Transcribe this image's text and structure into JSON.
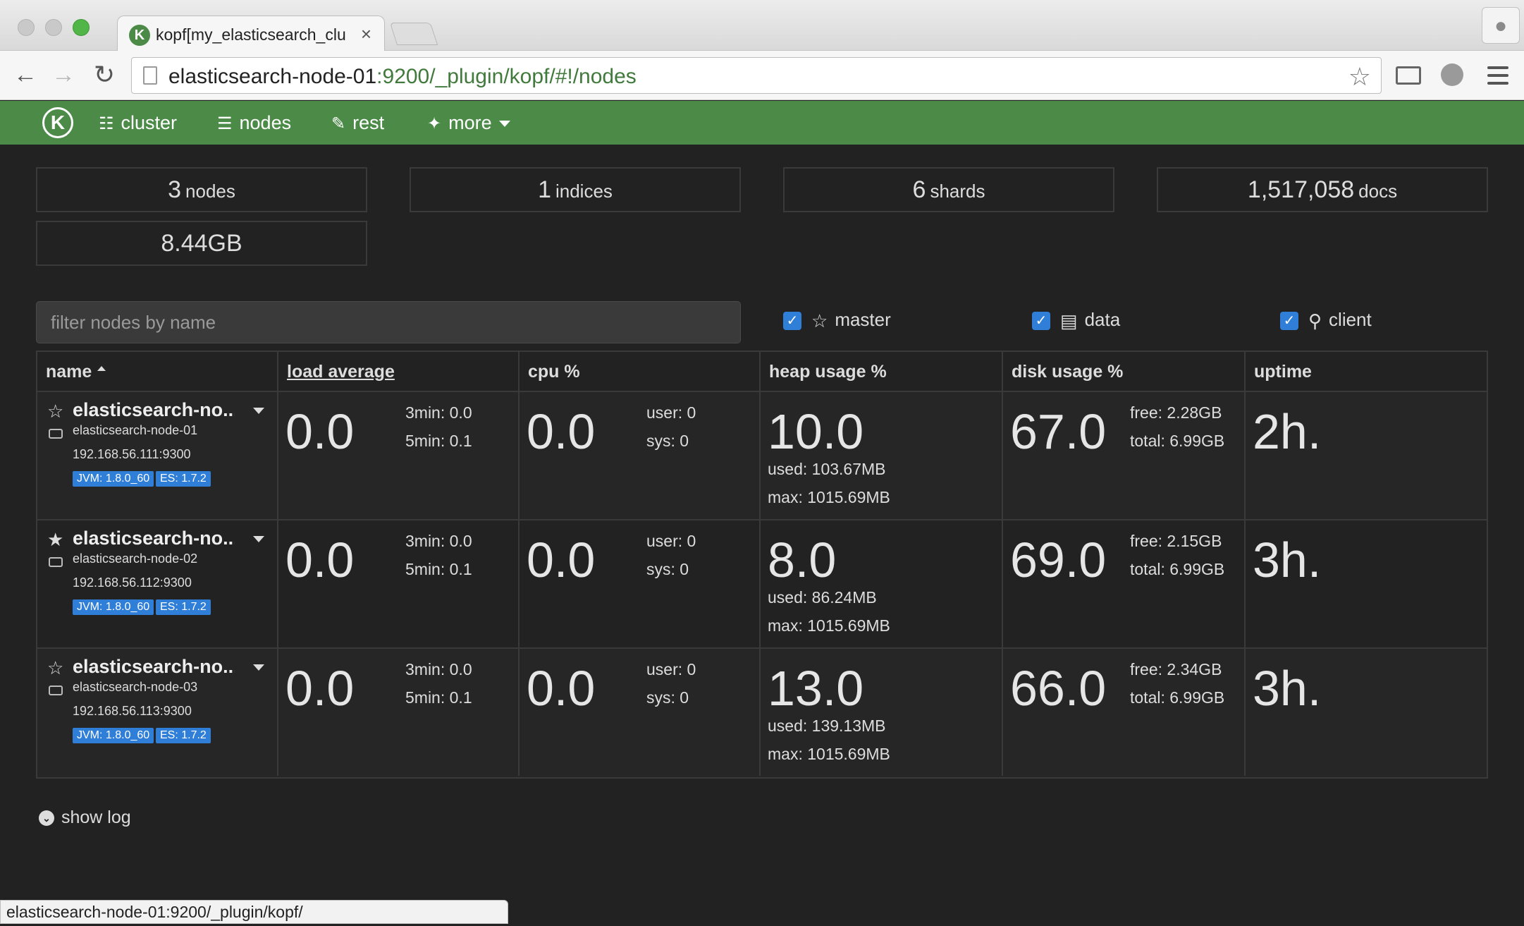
{
  "browser": {
    "tab_title": "kopf[my_elasticsearch_clus",
    "tab_close": "×",
    "url_host": "elasticsearch-node-01",
    "url_path": ":9200/_plugin/kopf/#!/nodes",
    "status_url": "elasticsearch-node-01:9200/_plugin/kopf/"
  },
  "navbar": {
    "brand": "K",
    "items": [
      {
        "label": "cluster",
        "icon": "sitemap-icon"
      },
      {
        "label": "nodes",
        "icon": "server-icon"
      },
      {
        "label": "rest",
        "icon": "edit-icon"
      },
      {
        "label": "more",
        "icon": "wand-icon"
      }
    ]
  },
  "stats": {
    "nodes": {
      "value": "3",
      "label": "nodes"
    },
    "indices": {
      "value": "1",
      "label": "indices"
    },
    "shards": {
      "value": "6",
      "label": "shards"
    },
    "docs": {
      "value": "1,517,058",
      "label": "docs"
    },
    "size": "8.44GB"
  },
  "filter": {
    "placeholder": "filter nodes by name",
    "roles": [
      {
        "label": "master",
        "checked": true,
        "icon": "star-outline-icon"
      },
      {
        "label": "data",
        "checked": true,
        "icon": "hdd-icon"
      },
      {
        "label": "client",
        "checked": true,
        "icon": "search-icon"
      }
    ]
  },
  "table": {
    "headers": {
      "name": "name",
      "load": "load average",
      "cpu": "cpu %",
      "heap": "heap usage %",
      "disk": "disk usage %",
      "uptime": "uptime"
    },
    "rows": [
      {
        "name": "elasticsearch-no...",
        "is_master": false,
        "host": "elasticsearch-node-01",
        "address": "192.168.56.111:9300",
        "jvm": "JVM: 1.8.0_60",
        "es": "ES: 1.7.2",
        "load": "0.0",
        "load_3min": "3min: 0.0",
        "load_5min": "5min: 0.1",
        "cpu": "0.0",
        "cpu_user": "user: 0",
        "cpu_sys": "sys: 0",
        "heap": "10.0",
        "heap_used": "used: 103.67MB",
        "heap_max": "max: 1015.69MB",
        "disk": "67.0",
        "disk_free": "free: 2.28GB",
        "disk_total": "total: 6.99GB",
        "uptime": "2h."
      },
      {
        "name": "elasticsearch-no...",
        "is_master": true,
        "host": "elasticsearch-node-02",
        "address": "192.168.56.112:9300",
        "jvm": "JVM: 1.8.0_60",
        "es": "ES: 1.7.2",
        "load": "0.0",
        "load_3min": "3min: 0.0",
        "load_5min": "5min: 0.1",
        "cpu": "0.0",
        "cpu_user": "user: 0",
        "cpu_sys": "sys: 0",
        "heap": "8.0",
        "heap_used": "used: 86.24MB",
        "heap_max": "max: 1015.69MB",
        "disk": "69.0",
        "disk_free": "free: 2.15GB",
        "disk_total": "total: 6.99GB",
        "uptime": "3h."
      },
      {
        "name": "elasticsearch-no...",
        "is_master": false,
        "host": "elasticsearch-node-03",
        "address": "192.168.56.113:9300",
        "jvm": "JVM: 1.8.0_60",
        "es": "ES: 1.7.2",
        "load": "0.0",
        "load_3min": "3min: 0.0",
        "load_5min": "5min: 0.1",
        "cpu": "0.0",
        "cpu_user": "user: 0",
        "cpu_sys": "sys: 0",
        "heap": "13.0",
        "heap_used": "used: 139.13MB",
        "heap_max": "max: 1015.69MB",
        "disk": "66.0",
        "disk_free": "free: 2.34GB",
        "disk_total": "total: 6.99GB",
        "uptime": "3h."
      }
    ]
  },
  "footer": {
    "show_log": "show log"
  },
  "colors": {
    "brand_green": "#4b8a47",
    "background": "#222222",
    "checkbox_blue": "#2f7ed8"
  }
}
